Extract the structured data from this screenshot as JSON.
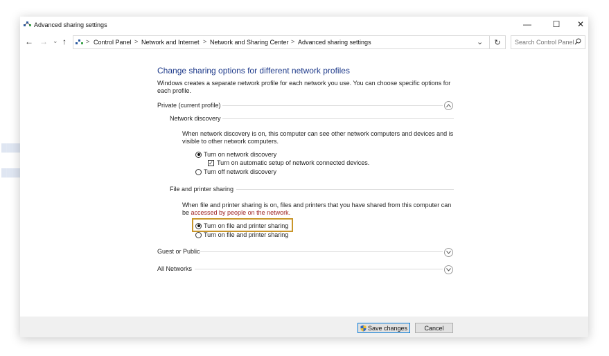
{
  "window": {
    "title": "Advanced sharing settings",
    "controls": {
      "minimize": "—",
      "maximize": "☐",
      "close": "✕"
    }
  },
  "nav": {
    "back": "←",
    "forward": "→",
    "recent": "⌄",
    "up": "↑"
  },
  "breadcrumb": {
    "items": [
      "Control Panel",
      "Network and Internet",
      "Network and Sharing Center",
      "Advanced sharing settings"
    ],
    "separator": ">",
    "dropdown": "⌄",
    "refresh": "↻"
  },
  "search": {
    "placeholder": "Search Control Panel"
  },
  "page": {
    "heading": "Change sharing options for different network profiles",
    "intro": "Windows creates a separate network profile for each network you use. You can choose specific options for each profile."
  },
  "private_profile": {
    "label": "Private (current profile)",
    "network_discovery": {
      "label": "Network discovery",
      "description": "When network discovery is on, this computer can see other network computers and devices and is visible to other network computers.",
      "options": [
        "Turn on network discovery",
        "Turn off network discovery"
      ],
      "selected": "Turn on network discovery",
      "auto_setup_label": "Turn on automatic setup of network connected devices.",
      "auto_setup_checked": true
    },
    "file_printer_sharing": {
      "label": "File and printer sharing",
      "description_part1": "When file and printer sharing is on, files and printers that you have shared from this computer can",
      "description_part2_prefix": "be ",
      "description_part2_red": "accessed by people on the network.",
      "option_on": "Turn on file and printer sharing",
      "option_off_partial": "Turn on file and printer sharing",
      "selected": "Turn on file and printer sharing"
    }
  },
  "guest_profile": {
    "label": "Guest or Public"
  },
  "all_networks": {
    "label": "All Networks"
  },
  "footer": {
    "save_label": "Save changes",
    "cancel_label": "Cancel"
  },
  "colors": {
    "heading": "#1e3a8a",
    "highlight": "#c9962a",
    "accent": "#0078d7",
    "warning_text": "#9b1c1c"
  }
}
